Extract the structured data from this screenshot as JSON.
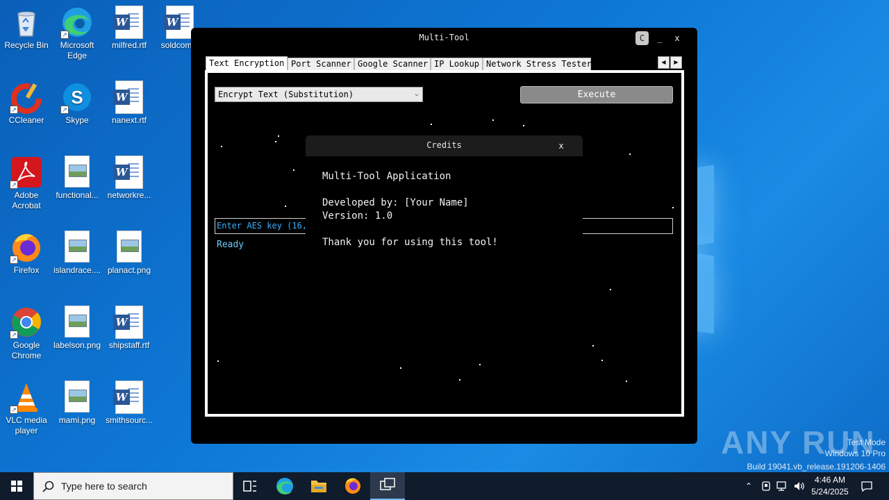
{
  "desktop": {
    "icons": [
      {
        "label": "Recycle Bin"
      },
      {
        "label": "Microsoft Edge"
      },
      {
        "label": "milfred.rtf"
      },
      {
        "label": "soldcom..."
      },
      {
        "label": "CCleaner"
      },
      {
        "label": "Skype"
      },
      {
        "label": "nanext.rtf"
      },
      {
        "label": "Adobe Acrobat"
      },
      {
        "label": "functional..."
      },
      {
        "label": "networkre..."
      },
      {
        "label": "Firefox"
      },
      {
        "label": "islandrace...."
      },
      {
        "label": "planact.png"
      },
      {
        "label": "Google Chrome"
      },
      {
        "label": "labelson.png"
      },
      {
        "label": "shipstaff.rtf"
      },
      {
        "label": "VLC media player"
      },
      {
        "label": "mami.png"
      },
      {
        "label": "smithsourc..."
      }
    ]
  },
  "window": {
    "title": "Multi-Tool",
    "controls": {
      "c": "C",
      "minimize": "_",
      "close": "x"
    },
    "tabs": [
      {
        "label": "Text Encryption",
        "active": true
      },
      {
        "label": "Port Scanner"
      },
      {
        "label": "Google Scanner"
      },
      {
        "label": "IP Lookup"
      },
      {
        "label": "Network Stress Tester"
      }
    ],
    "tab_scroll": {
      "left": "◀",
      "right": "▶"
    },
    "mode_select": {
      "value": "Encrypt Text (Substitution)",
      "chevron": "⌵"
    },
    "execute_label": "Execute",
    "key_input_placeholder": "Enter AES key (16,",
    "status": "Ready"
  },
  "credits_dialog": {
    "title": "Credits",
    "close": "x",
    "app_name": "Multi-Tool Application",
    "developer": "Developed by: [Your Name]",
    "version": "Version: 1.0",
    "thanks": "Thank you for using this tool!"
  },
  "watermark": {
    "brand": "ANY RUN",
    "line1": "Test Mode",
    "line2": "Windows 10 Pro",
    "line3": "Build 19041.vb_release.191206-1406"
  },
  "taskbar": {
    "search_placeholder": "Type here to search",
    "time": "4:46 AM",
    "date": "5/24/2025",
    "tray": {
      "chevron": "⌃"
    }
  },
  "colors": {
    "accent": "#0e78d6",
    "status_text": "#6ecbff",
    "taskbar": "#101b2b"
  }
}
